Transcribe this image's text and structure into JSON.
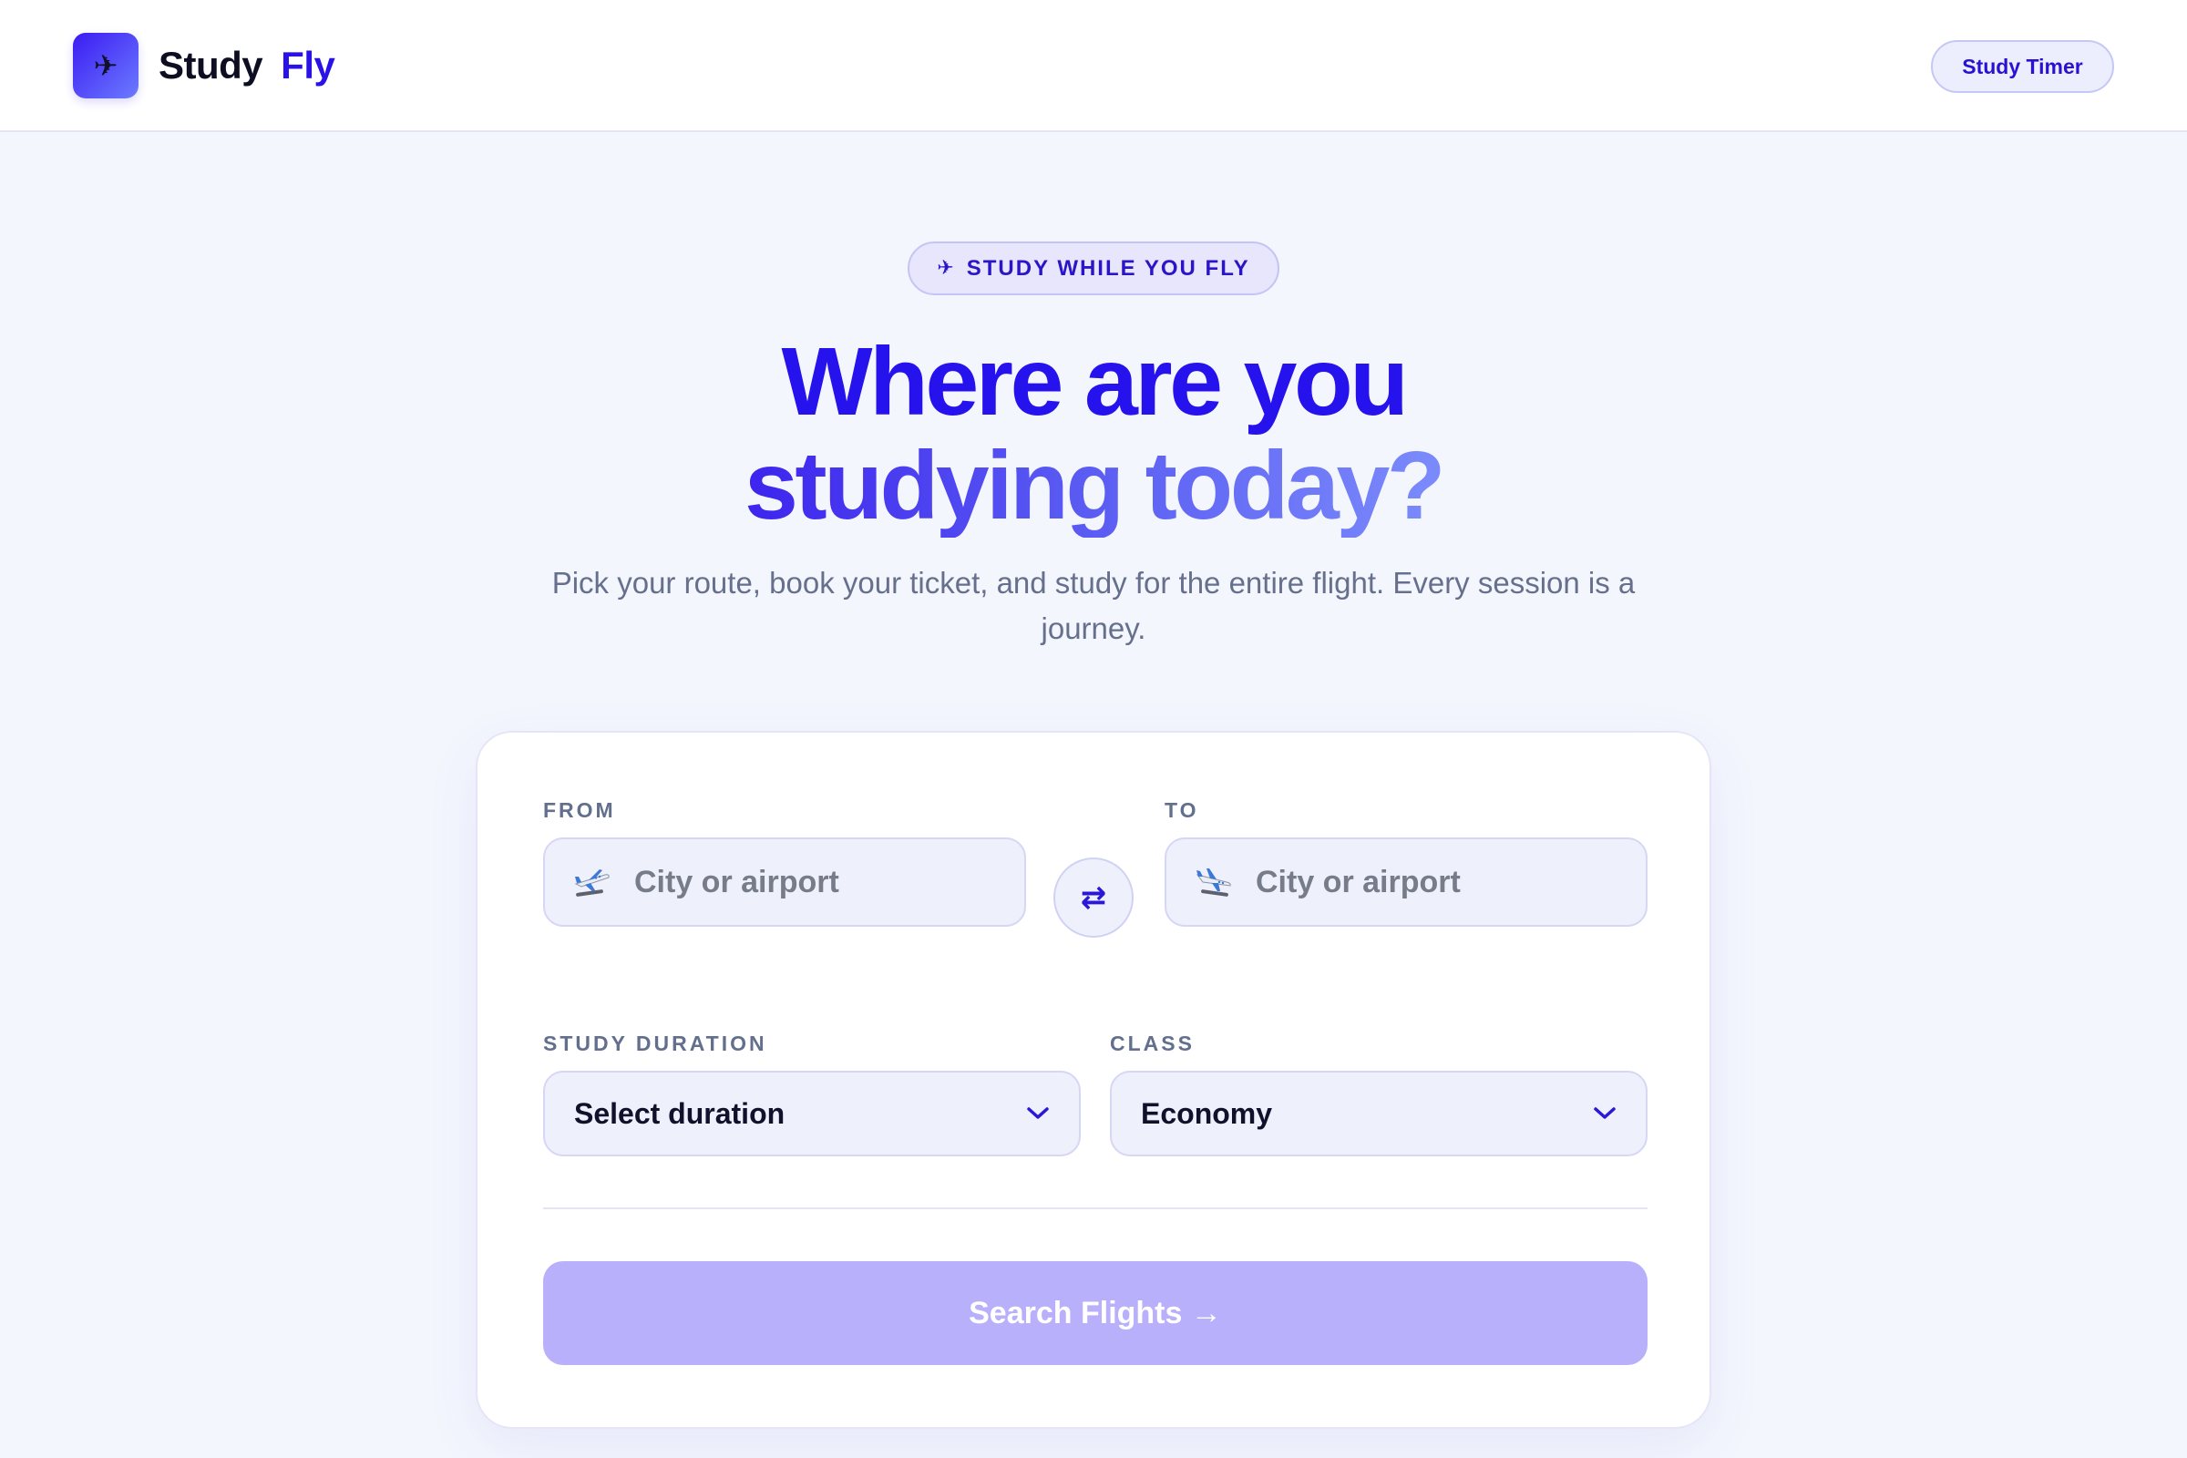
{
  "header": {
    "logo_icon": "airplane-icon",
    "brand_study": "Study",
    "brand_fly": "Fly",
    "timer_label": "Study Timer"
  },
  "hero": {
    "badge_icon": "airplane-icon",
    "badge_text": "STUDY WHILE YOU FLY",
    "headline_line1": "Where are you",
    "headline_line2": "studying today?",
    "subhead": "Pick your route, book your ticket, and study for the entire flight. Every session is a journey."
  },
  "form": {
    "from": {
      "label": "FROM",
      "placeholder": "City or airport",
      "value": "",
      "icon": "departure-plane-icon"
    },
    "swap_icon": "swap-arrows-icon",
    "swap_symbol": "⇄",
    "to": {
      "label": "TO",
      "placeholder": "City or airport",
      "value": "",
      "icon": "arrival-plane-icon"
    },
    "duration": {
      "label": "STUDY DURATION",
      "selected": "Select duration"
    },
    "class": {
      "label": "CLASS",
      "selected": "Economy"
    },
    "search_label": "Search Flights →"
  },
  "colors": {
    "accent": "#2a11e6",
    "background": "#f4f6fe",
    "search_button": "#b8b0fb",
    "muted_text": "#66708c"
  }
}
